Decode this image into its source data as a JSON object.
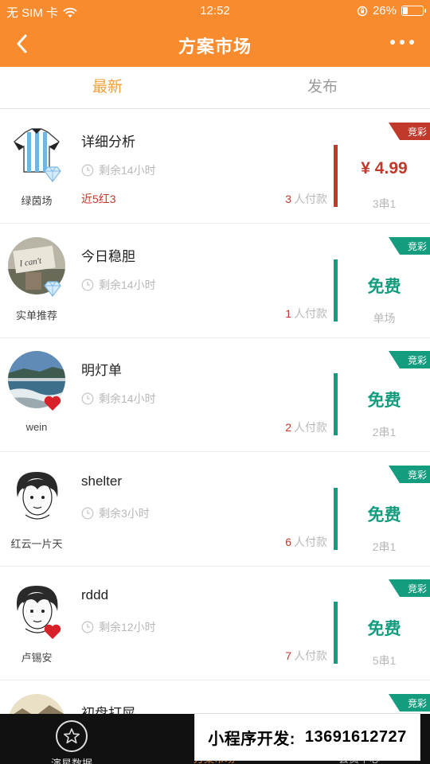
{
  "status": {
    "carrier": "无 SIM 卡",
    "time": "12:52",
    "battery": "26%",
    "battery_level": 0.26
  },
  "nav": {
    "title": "方案市场"
  },
  "tabs": [
    {
      "label": "最新",
      "active": true
    },
    {
      "label": "发布",
      "active": false
    }
  ],
  "colors": {
    "header": "#f98b2f",
    "paid": "#c0392b",
    "free": "#149c7f",
    "tab_active": "#f0a33c"
  },
  "items": [
    {
      "title": "详细分析",
      "nickname": "绿茵场",
      "remain": "剩余14小时",
      "record": "近5红3",
      "payers_count": "3",
      "payers_label": "人付款",
      "price": "¥ 4.99",
      "price_type": "paid",
      "play_type": "3串1",
      "tag": "竞彩",
      "avatar": "jersey-avatar",
      "badge": "diamond"
    },
    {
      "title": "今日稳胆",
      "nickname": "实单推荐",
      "remain": "剩余14小时",
      "record": "",
      "payers_count": "1",
      "payers_label": "人付款",
      "price": "免费",
      "price_type": "free",
      "play_type": "单场",
      "tag": "竞彩",
      "avatar": "sign-avatar",
      "badge": "diamond"
    },
    {
      "title": "明灯单",
      "nickname": "wein",
      "remain": "剩余14小时",
      "record": "",
      "payers_count": "2",
      "payers_label": "人付款",
      "price": "免费",
      "price_type": "free",
      "play_type": "2串1",
      "tag": "竞彩",
      "avatar": "sea-avatar",
      "badge": "heart"
    },
    {
      "title": "shelter",
      "nickname": "红云一片天",
      "remain": "剩余3小时",
      "record": "",
      "payers_count": "6",
      "payers_label": "人付款",
      "price": "免费",
      "price_type": "free",
      "play_type": "2串1",
      "tag": "竞彩",
      "avatar": "cartoon-avatar",
      "badge": ""
    },
    {
      "title": "rddd",
      "nickname": "卢锡安",
      "remain": "剩余12小时",
      "record": "",
      "payers_count": "7",
      "payers_label": "人付款",
      "price": "免费",
      "price_type": "free",
      "play_type": "5串1",
      "tag": "竞彩",
      "avatar": "cartoon-avatar",
      "badge": "heart"
    },
    {
      "title": "初盘打屎",
      "nickname": "",
      "remain": "",
      "record": "",
      "payers_count": "",
      "payers_label": "",
      "price": "",
      "price_type": "free",
      "play_type": "",
      "tag": "竞彩",
      "avatar": "landscape-avatar",
      "badge": ""
    }
  ],
  "bottom": {
    "tab1": "演星数据",
    "tab2": "方案市场",
    "tab3": "会员中心"
  },
  "ad": {
    "label": "小程序开发:",
    "phone": "13691612727"
  }
}
